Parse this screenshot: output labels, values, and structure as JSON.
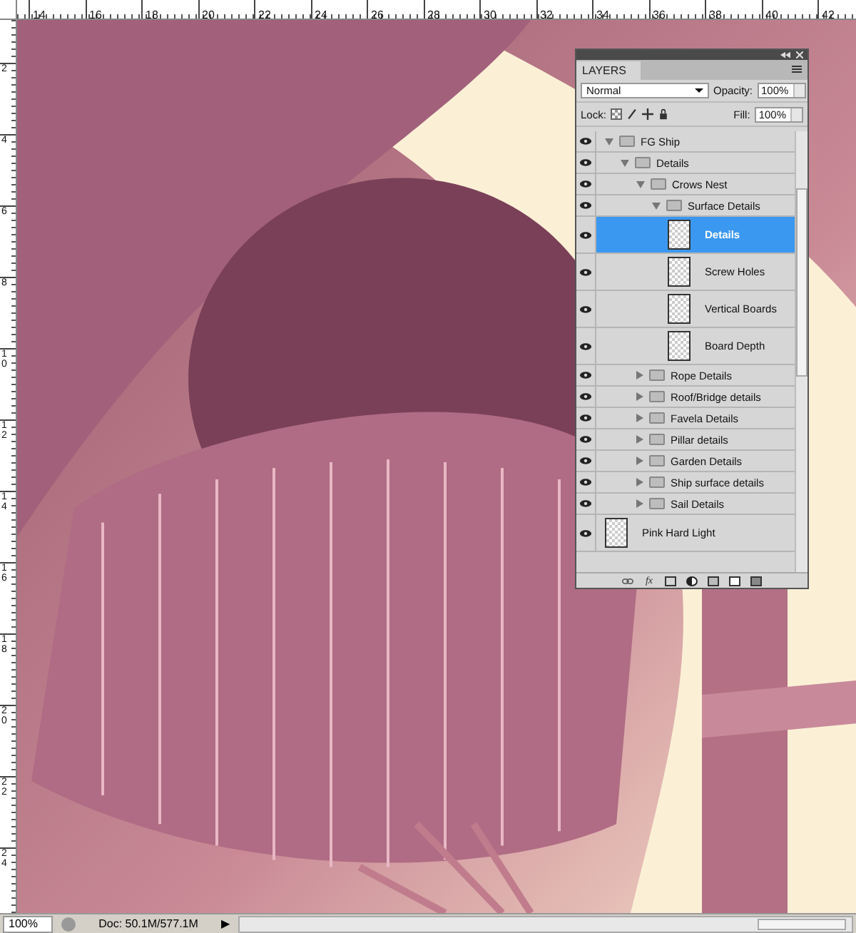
{
  "rulers": {
    "horizontal": [
      "14",
      "16",
      "18",
      "20",
      "22",
      "24",
      "26",
      "28",
      "30",
      "32",
      "34",
      "36",
      "38",
      "40",
      "42"
    ],
    "vertical": [
      "2",
      "4",
      "6",
      "8",
      "10",
      "12",
      "14",
      "16",
      "18",
      "20",
      "22",
      "24"
    ]
  },
  "layers_panel": {
    "tab": "LAYERS",
    "blend_mode": "Normal",
    "opacity_label": "Opacity:",
    "opacity": "100%",
    "lock_label": "Lock:",
    "fill_label": "Fill:",
    "fill": "100%",
    "effects_button": "fx",
    "layers": [
      {
        "name": "FG Ship",
        "kind": "group",
        "visible": true,
        "expanded": true,
        "selected": false,
        "children": [
          {
            "name": "Details",
            "kind": "group",
            "visible": true,
            "expanded": true,
            "selected": false,
            "children": [
              {
                "name": "Crows Nest",
                "kind": "group",
                "visible": true,
                "expanded": true,
                "selected": false,
                "children": [
                  {
                    "name": "Surface Details",
                    "kind": "group",
                    "visible": true,
                    "expanded": true,
                    "selected": false,
                    "children": [
                      {
                        "name": "Details",
                        "kind": "layer",
                        "visible": true,
                        "selected": true
                      },
                      {
                        "name": "Screw Holes",
                        "kind": "layer",
                        "visible": true,
                        "selected": false
                      },
                      {
                        "name": "Vertical Boards",
                        "kind": "layer",
                        "visible": true,
                        "selected": false
                      },
                      {
                        "name": "Board Depth",
                        "kind": "layer",
                        "visible": true,
                        "selected": false
                      }
                    ]
                  }
                ]
              },
              {
                "name": "Rope Details",
                "kind": "group",
                "visible": true,
                "expanded": false,
                "selected": false
              },
              {
                "name": "Roof/Bridge details",
                "kind": "group",
                "visible": true,
                "expanded": false,
                "selected": false
              },
              {
                "name": "Favela Details",
                "kind": "group",
                "visible": true,
                "expanded": false,
                "selected": false
              },
              {
                "name": "Pillar details",
                "kind": "group",
                "visible": true,
                "expanded": false,
                "selected": false
              },
              {
                "name": "Garden Details",
                "kind": "group",
                "visible": true,
                "expanded": false,
                "selected": false
              },
              {
                "name": "Ship surface details",
                "kind": "group",
                "visible": true,
                "expanded": false,
                "selected": false
              },
              {
                "name": "Sail Details",
                "kind": "group",
                "visible": true,
                "expanded": false,
                "selected": false
              }
            ]
          }
        ]
      },
      {
        "name": "Pink Hard Light",
        "kind": "layer",
        "visible": true,
        "selected": false
      }
    ]
  },
  "status_bar": {
    "zoom": "100%",
    "doc_size": "Doc: 50.1M/577.1M",
    "menu_arrow": "▶"
  }
}
